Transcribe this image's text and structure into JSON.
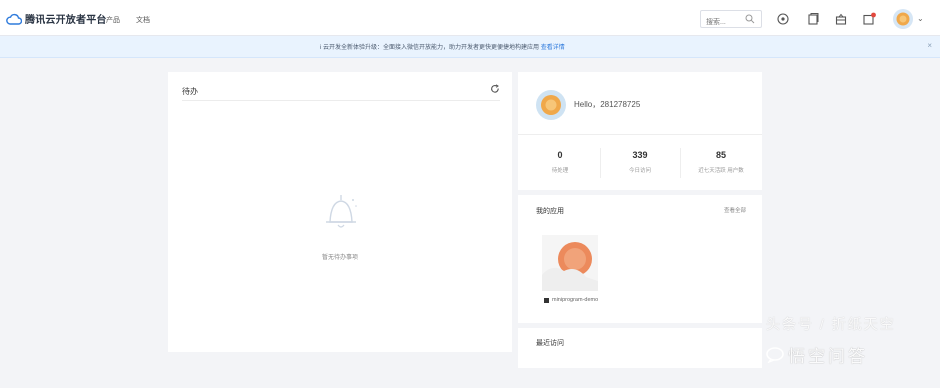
{
  "topbar": {
    "logo_text": "腾讯云开放者平台",
    "nav": [
      "产品",
      "文档"
    ],
    "search_placeholder": "搜索...",
    "tools": [
      "notification-icon",
      "document-icon",
      "gift-icon",
      "message-icon"
    ],
    "colors": {
      "accent": "#2f7bdc",
      "avatar": "#f0a84a"
    }
  },
  "notice": {
    "text": "i  云开发全新体验升级：全面接入微信开放能力，助力开发者更快更便捷地构建应用",
    "link": "查看详情",
    "close": "×"
  },
  "tasks": {
    "title": "待办",
    "empty_text": "暂无待办事项"
  },
  "user": {
    "greeting": "Hello，281278725",
    "stats": [
      {
        "value": "0",
        "label": "待处理"
      },
      {
        "value": "339",
        "label": "今日访问"
      },
      {
        "value": "85",
        "label": "近七天活跃 用户数"
      }
    ]
  },
  "apps": {
    "title": "我的应用",
    "more": "查看全部",
    "items": [
      {
        "name": "miniprogram-demo"
      }
    ]
  },
  "recent": {
    "title": "最近访问"
  },
  "watermark": {
    "line1": "头条号 / 折纸天空",
    "line2": "悟空问答"
  }
}
